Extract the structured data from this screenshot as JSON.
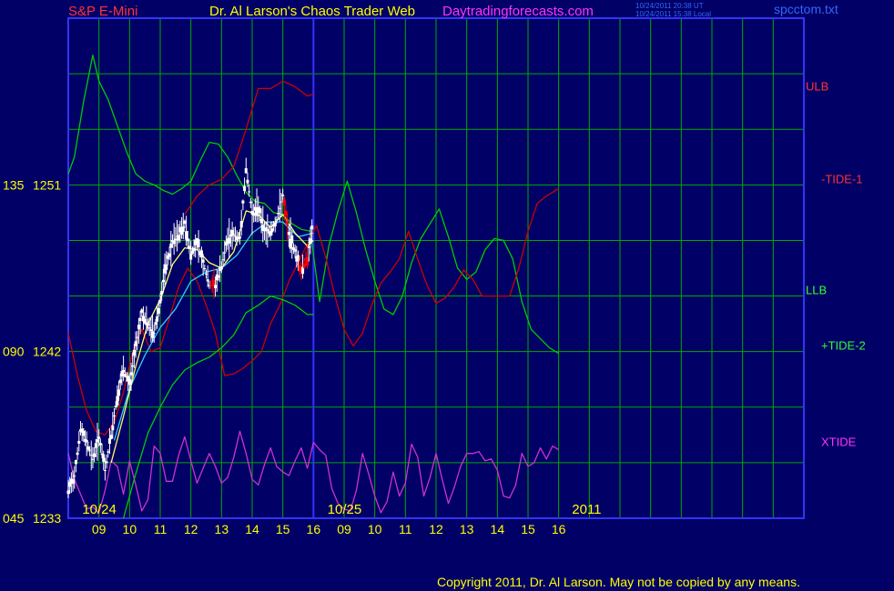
{
  "header": {
    "symbol": "S&P E-Mini",
    "title": "Dr. Al Larson's Chaos Trader Web",
    "site": "Daytradingforecasts.com",
    "stamp_ut": "10/24/2011 20:38 UT",
    "stamp_local": "10/24/2011 15:38 Local",
    "file": "spcctom.txt"
  },
  "footer": {
    "copyright": "Copyright 2011, Dr. Al Larson. May not be copied by any means."
  },
  "colors": {
    "background": "#000066",
    "grid": "#00aa00",
    "price": "#ffffff",
    "price_down": "#ff0000",
    "tide1": "#cc0000",
    "tide2": "#00cc00",
    "xtide": "#cc33cc",
    "avg_fast": "#ffff66",
    "avg_slow": "#33ccff",
    "header_red": "#ff3333",
    "header_yellow": "#ffff00",
    "header_magenta": "#ff33ff",
    "header_blue": "#3366ff"
  },
  "chart_data": {
    "type": "line",
    "ylim": [
      1233,
      1260
    ],
    "y_ticks": [
      {
        "value": 1251,
        "label": "1251",
        "prefix": "135"
      },
      {
        "value": 1242,
        "label": "1242",
        "prefix": "090"
      },
      {
        "value": 1233,
        "label": "1233",
        "prefix": "045"
      }
    ],
    "x_range_hours": [
      8,
      32
    ],
    "x_ticks": [
      {
        "hour": 9,
        "label": "09"
      },
      {
        "hour": 10,
        "label": "10"
      },
      {
        "hour": 11,
        "label": "11"
      },
      {
        "hour": 12,
        "label": "12"
      },
      {
        "hour": 13,
        "label": "13"
      },
      {
        "hour": 14,
        "label": "14"
      },
      {
        "hour": 15,
        "label": "15"
      },
      {
        "hour": 16,
        "label": "16"
      },
      {
        "hour": 17,
        "label": "09"
      },
      {
        "hour": 18,
        "label": "10"
      },
      {
        "hour": 19,
        "label": "11"
      },
      {
        "hour": 20,
        "label": "12"
      },
      {
        "hour": 21,
        "label": "13"
      },
      {
        "hour": 22,
        "label": "14"
      },
      {
        "hour": 23,
        "label": "15"
      },
      {
        "hour": 24,
        "label": "16"
      }
    ],
    "date_labels": [
      {
        "hour": 8.3,
        "label": "10/24"
      },
      {
        "hour": 16.3,
        "label": "10/25"
      },
      {
        "hour": 24.2,
        "label": "2011"
      }
    ],
    "day_divider_hour": 16,
    "series_labels": [
      {
        "label": "ULB",
        "color": "#ff3333",
        "y": 1256.1
      },
      {
        "label": "-TIDE-1",
        "color": "#ff3333",
        "y": 1251.1
      },
      {
        "label": "LLB",
        "color": "#33ff33",
        "y": 1245.1
      },
      {
        "label": "+TIDE-2",
        "color": "#33ff33",
        "y": 1242.1
      },
      {
        "label": "XTIDE",
        "color": "#ff33ff",
        "y": 1236.9
      }
    ],
    "price": [
      [
        8.0,
        1234.5
      ],
      [
        8.2,
        1235.3
      ],
      [
        8.4,
        1237.8
      ],
      [
        8.6,
        1237.1
      ],
      [
        8.8,
        1236.2
      ],
      [
        9.0,
        1237.4
      ],
      [
        9.2,
        1235.6
      ],
      [
        9.4,
        1237.5
      ],
      [
        9.6,
        1239.6
      ],
      [
        9.8,
        1241.0
      ],
      [
        10.0,
        1240.2
      ],
      [
        10.2,
        1242.3
      ],
      [
        10.4,
        1244.1
      ],
      [
        10.6,
        1243.4
      ],
      [
        10.8,
        1243.0
      ],
      [
        11.0,
        1244.8
      ],
      [
        11.2,
        1246.7
      ],
      [
        11.4,
        1247.9
      ],
      [
        11.6,
        1248.3
      ],
      [
        11.8,
        1248.9
      ],
      [
        12.0,
        1247.3
      ],
      [
        12.2,
        1247.9
      ],
      [
        12.4,
        1246.8
      ],
      [
        12.6,
        1245.6
      ],
      [
        12.8,
        1245.6
      ],
      [
        13.0,
        1246.6
      ],
      [
        13.2,
        1248.1
      ],
      [
        13.4,
        1248.3
      ],
      [
        13.6,
        1248.1
      ],
      [
        13.8,
        1251.9
      ],
      [
        14.0,
        1249.4
      ],
      [
        14.2,
        1249.8
      ],
      [
        14.4,
        1248.5
      ],
      [
        14.6,
        1248.5
      ],
      [
        14.8,
        1249.1
      ],
      [
        15.0,
        1250.4
      ],
      [
        15.2,
        1248.3
      ],
      [
        15.4,
        1247.4
      ],
      [
        15.6,
        1246.4
      ],
      [
        15.8,
        1247.1
      ],
      [
        16.0,
        1249.1
      ]
    ],
    "tide1": [
      [
        8.0,
        1243.0
      ],
      [
        8.3,
        1240.7
      ],
      [
        8.6,
        1238.8
      ],
      [
        8.9,
        1237.7
      ],
      [
        9.2,
        1237.5
      ],
      [
        9.5,
        1238.2
      ],
      [
        9.8,
        1239.8
      ],
      [
        10.1,
        1242.0
      ],
      [
        10.4,
        1243.2
      ],
      [
        10.7,
        1242.0
      ],
      [
        11.0,
        1242.2
      ],
      [
        11.3,
        1243.8
      ],
      [
        11.6,
        1245.5
      ],
      [
        11.9,
        1246.5
      ],
      [
        12.2,
        1245.8
      ],
      [
        12.5,
        1244.5
      ],
      [
        12.8,
        1243.0
      ],
      [
        13.1,
        1240.7
      ],
      [
        13.4,
        1240.8
      ],
      [
        13.7,
        1241.1
      ],
      [
        14.0,
        1241.5
      ],
      [
        14.3,
        1242.0
      ],
      [
        14.6,
        1243.5
      ],
      [
        14.9,
        1244.5
      ],
      [
        15.2,
        1245.8
      ],
      [
        15.5,
        1246.8
      ],
      [
        15.8,
        1247.8
      ],
      [
        16.1,
        1248.8
      ],
      [
        16.4,
        1247.1
      ],
      [
        16.7,
        1245.0
      ],
      [
        17.0,
        1243.2
      ],
      [
        17.3,
        1242.3
      ],
      [
        17.6,
        1243.0
      ],
      [
        17.9,
        1244.5
      ],
      [
        18.2,
        1245.7
      ],
      [
        18.5,
        1246.3
      ],
      [
        18.8,
        1247.0
      ],
      [
        19.1,
        1248.5
      ],
      [
        19.4,
        1247.0
      ],
      [
        19.7,
        1245.6
      ],
      [
        20.0,
        1244.6
      ],
      [
        20.3,
        1244.9
      ],
      [
        20.6,
        1245.5
      ],
      [
        20.9,
        1246.4
      ],
      [
        21.2,
        1245.9
      ],
      [
        21.5,
        1245.0
      ],
      [
        21.8,
        1245.0
      ],
      [
        22.1,
        1245.0
      ],
      [
        22.4,
        1245.0
      ],
      [
        22.7,
        1246.5
      ],
      [
        23.0,
        1248.5
      ],
      [
        23.3,
        1250.0
      ],
      [
        23.6,
        1250.4
      ],
      [
        23.9,
        1250.7
      ],
      [
        24.0,
        1250.8
      ]
    ],
    "tide2": [
      [
        8.0,
        1251.6
      ],
      [
        8.2,
        1252.5
      ],
      [
        8.5,
        1255.5
      ],
      [
        8.8,
        1258.0
      ],
      [
        9.0,
        1256.6
      ],
      [
        9.3,
        1255.6
      ],
      [
        9.6,
        1254.2
      ],
      [
        9.9,
        1252.8
      ],
      [
        10.2,
        1251.6
      ],
      [
        10.5,
        1251.2
      ],
      [
        10.8,
        1251.0
      ],
      [
        11.1,
        1250.7
      ],
      [
        11.4,
        1250.5
      ],
      [
        11.7,
        1250.8
      ],
      [
        12.0,
        1251.2
      ],
      [
        12.3,
        1252.3
      ],
      [
        12.6,
        1253.3
      ],
      [
        12.9,
        1253.2
      ],
      [
        13.2,
        1252.5
      ],
      [
        13.5,
        1251.5
      ],
      [
        13.8,
        1250.6
      ],
      [
        14.1,
        1250.1
      ],
      [
        14.4,
        1250.0
      ],
      [
        14.7,
        1249.5
      ],
      [
        15.0,
        1249.4
      ],
      [
        15.3,
        1248.9
      ],
      [
        15.6,
        1248.6
      ],
      [
        15.9,
        1248.5
      ],
      [
        16.2,
        1244.7
      ],
      [
        16.5,
        1247.7
      ],
      [
        16.8,
        1249.6
      ],
      [
        17.1,
        1251.2
      ],
      [
        17.4,
        1249.5
      ],
      [
        17.7,
        1247.5
      ],
      [
        18.0,
        1245.8
      ],
      [
        18.3,
        1244.3
      ],
      [
        18.6,
        1244.0
      ],
      [
        18.9,
        1245.0
      ],
      [
        19.2,
        1246.8
      ],
      [
        19.5,
        1248.1
      ],
      [
        19.8,
        1248.9
      ],
      [
        20.1,
        1249.7
      ],
      [
        20.4,
        1248.2
      ],
      [
        20.7,
        1246.5
      ],
      [
        21.0,
        1245.9
      ],
      [
        21.3,
        1246.3
      ],
      [
        21.6,
        1247.5
      ],
      [
        21.9,
        1248.1
      ],
      [
        22.2,
        1248.0
      ],
      [
        22.5,
        1247.0
      ],
      [
        22.8,
        1244.7
      ],
      [
        23.1,
        1243.2
      ],
      [
        23.4,
        1242.7
      ],
      [
        23.7,
        1242.2
      ],
      [
        24.0,
        1241.9
      ]
    ],
    "ulb": [
      [
        11.8,
        1249.4
      ],
      [
        12.2,
        1250.4
      ],
      [
        12.6,
        1251.0
      ],
      [
        13.0,
        1251.3
      ],
      [
        13.4,
        1252.0
      ],
      [
        13.8,
        1254.0
      ],
      [
        14.2,
        1256.2
      ],
      [
        14.6,
        1256.2
      ],
      [
        15.0,
        1256.6
      ],
      [
        15.4,
        1256.3
      ],
      [
        15.8,
        1255.8
      ],
      [
        16.0,
        1255.9
      ]
    ],
    "llb": [
      [
        9.8,
        1233.0
      ],
      [
        10.2,
        1235.4
      ],
      [
        10.6,
        1237.6
      ],
      [
        11.0,
        1239.0
      ],
      [
        11.4,
        1240.2
      ],
      [
        11.8,
        1241.0
      ],
      [
        12.2,
        1241.4
      ],
      [
        12.6,
        1241.7
      ],
      [
        13.0,
        1242.2
      ],
      [
        13.4,
        1242.9
      ],
      [
        13.8,
        1244.1
      ],
      [
        14.2,
        1244.5
      ],
      [
        14.6,
        1245.0
      ],
      [
        15.0,
        1244.8
      ],
      [
        15.4,
        1244.5
      ],
      [
        15.8,
        1244.0
      ],
      [
        16.0,
        1244.0
      ]
    ],
    "avg_fast": [
      [
        9.4,
        1236.0
      ],
      [
        9.8,
        1238.5
      ],
      [
        10.2,
        1241.2
      ],
      [
        10.6,
        1243.5
      ],
      [
        11.0,
        1244.8
      ],
      [
        11.4,
        1246.7
      ],
      [
        11.8,
        1247.6
      ],
      [
        12.2,
        1247.5
      ],
      [
        12.6,
        1246.8
      ],
      [
        13.0,
        1246.5
      ],
      [
        13.4,
        1247.4
      ],
      [
        13.8,
        1249.6
      ],
      [
        14.2,
        1249.4
      ],
      [
        14.6,
        1248.7
      ],
      [
        15.0,
        1249.4
      ],
      [
        15.4,
        1248.4
      ],
      [
        15.8,
        1247.7
      ],
      [
        16.0,
        1248.0
      ]
    ],
    "avg_slow": [
      [
        9.5,
        1237.2
      ],
      [
        10.0,
        1240.0
      ],
      [
        10.5,
        1241.8
      ],
      [
        11.0,
        1243.3
      ],
      [
        11.5,
        1244.3
      ],
      [
        12.0,
        1245.8
      ],
      [
        12.5,
        1246.3
      ],
      [
        13.0,
        1246.5
      ],
      [
        13.5,
        1247.2
      ],
      [
        14.0,
        1248.4
      ],
      [
        14.5,
        1249.0
      ],
      [
        15.0,
        1249.0
      ],
      [
        15.5,
        1248.2
      ],
      [
        16.0,
        1248.4
      ]
    ],
    "xtide": [
      [
        8.0,
        1236.5
      ],
      [
        8.2,
        1235.1
      ],
      [
        8.4,
        1234.3
      ],
      [
        8.6,
        1233.5
      ],
      [
        8.8,
        1233.6
      ],
      [
        9.0,
        1233.3
      ],
      [
        9.2,
        1234.5
      ],
      [
        9.4,
        1236.1
      ],
      [
        9.6,
        1235.8
      ],
      [
        9.8,
        1234.3
      ],
      [
        10.0,
        1236.1
      ],
      [
        10.2,
        1234.8
      ],
      [
        10.4,
        1233.4
      ],
      [
        10.6,
        1234.0
      ],
      [
        10.8,
        1236.9
      ],
      [
        11.0,
        1236.5
      ],
      [
        11.2,
        1235.0
      ],
      [
        11.4,
        1235.0
      ],
      [
        11.6,
        1236.4
      ],
      [
        11.8,
        1237.4
      ],
      [
        12.0,
        1236.1
      ],
      [
        12.2,
        1234.9
      ],
      [
        12.4,
        1235.7
      ],
      [
        12.6,
        1236.5
      ],
      [
        12.8,
        1235.8
      ],
      [
        13.0,
        1234.9
      ],
      [
        13.2,
        1235.2
      ],
      [
        13.4,
        1236.3
      ],
      [
        13.6,
        1237.7
      ],
      [
        13.8,
        1236.5
      ],
      [
        14.0,
        1235.1
      ],
      [
        14.2,
        1234.8
      ],
      [
        14.4,
        1235.9
      ],
      [
        14.6,
        1236.8
      ],
      [
        14.8,
        1235.8
      ],
      [
        15.0,
        1235.5
      ],
      [
        15.2,
        1235.3
      ],
      [
        15.4,
        1236.1
      ],
      [
        15.6,
        1236.8
      ],
      [
        15.8,
        1235.7
      ],
      [
        16.0,
        1237.1
      ],
      [
        16.2,
        1236.7
      ],
      [
        16.4,
        1236.4
      ],
      [
        16.6,
        1234.6
      ],
      [
        16.8,
        1233.8
      ],
      [
        17.0,
        1233.5
      ],
      [
        17.2,
        1233.4
      ],
      [
        17.4,
        1234.5
      ],
      [
        17.6,
        1236.5
      ],
      [
        17.8,
        1235.4
      ],
      [
        18.0,
        1234.2
      ],
      [
        18.2,
        1233.3
      ],
      [
        18.4,
        1233.9
      ],
      [
        18.6,
        1235.5
      ],
      [
        18.8,
        1234.2
      ],
      [
        19.0,
        1234.9
      ],
      [
        19.2,
        1237.0
      ],
      [
        19.4,
        1236.3
      ],
      [
        19.6,
        1234.2
      ],
      [
        19.8,
        1235.2
      ],
      [
        20.0,
        1236.5
      ],
      [
        20.2,
        1235.1
      ],
      [
        20.4,
        1233.8
      ],
      [
        20.6,
        1234.7
      ],
      [
        20.8,
        1235.8
      ],
      [
        21.0,
        1236.5
      ],
      [
        21.2,
        1236.5
      ],
      [
        21.4,
        1236.6
      ],
      [
        21.6,
        1236.1
      ],
      [
        21.8,
        1236.2
      ],
      [
        22.0,
        1235.6
      ],
      [
        22.2,
        1234.2
      ],
      [
        22.4,
        1234.1
      ],
      [
        22.6,
        1234.8
      ],
      [
        22.8,
        1236.5
      ],
      [
        23.0,
        1235.8
      ],
      [
        23.2,
        1236.0
      ],
      [
        23.4,
        1236.8
      ],
      [
        23.6,
        1236.2
      ],
      [
        23.8,
        1236.9
      ],
      [
        24.0,
        1236.7
      ]
    ]
  }
}
